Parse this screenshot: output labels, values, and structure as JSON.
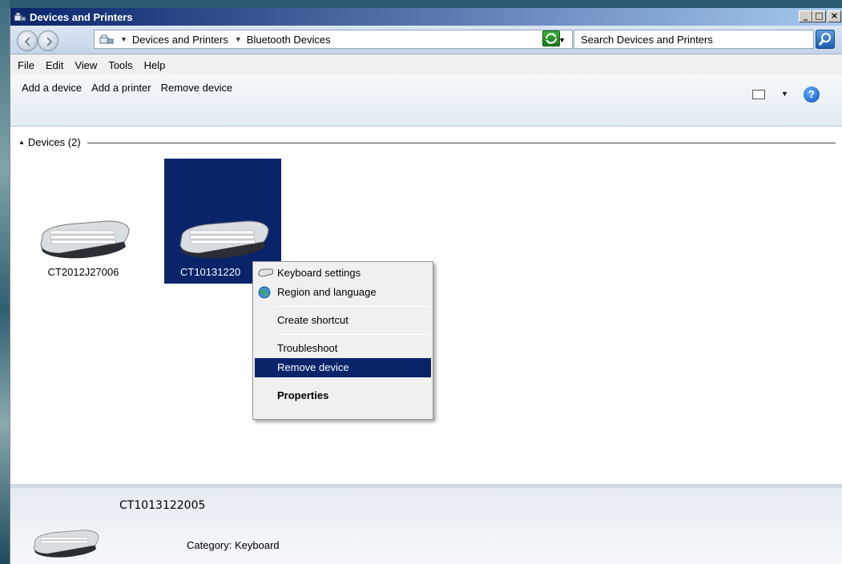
{
  "window": {
    "title": "Devices and Printers",
    "min_label": "_",
    "max_label": "□",
    "close_label": "×"
  },
  "address": {
    "crumbs": [
      "Devices and Printers",
      "Bluetooth Devices"
    ],
    "search_placeholder": "Search Devices and Printers"
  },
  "menu": [
    "File",
    "Edit",
    "View",
    "Tools",
    "Help"
  ],
  "command_bar": {
    "items": [
      "Add a device",
      "Add a printer",
      "Remove device"
    ],
    "help_label": "?"
  },
  "group": {
    "label": "Devices (2)"
  },
  "devices": [
    {
      "name": "CT2012J27006",
      "icon": "keyboard-icon"
    },
    {
      "name": "CT1013122005",
      "label_visible": "CT10131220",
      "icon": "keyboard-icon"
    }
  ],
  "context_menu": {
    "items": [
      {
        "label": "Keyboard settings",
        "icon": "keyboard-icon"
      },
      {
        "label": "Region and language",
        "icon": "globe-icon"
      },
      {
        "label": "Create shortcut"
      },
      {
        "label": "Troubleshoot"
      },
      {
        "label": "Remove device",
        "highlighted": true
      },
      {
        "label": "Properties",
        "bold": true
      }
    ]
  },
  "details": {
    "name": "CT1013122005",
    "category_line": "Category: Keyboard"
  },
  "colors": {
    "selection": "#0a246a",
    "titlebar_start": "#0a246a",
    "titlebar_end": "#a6caf0"
  }
}
